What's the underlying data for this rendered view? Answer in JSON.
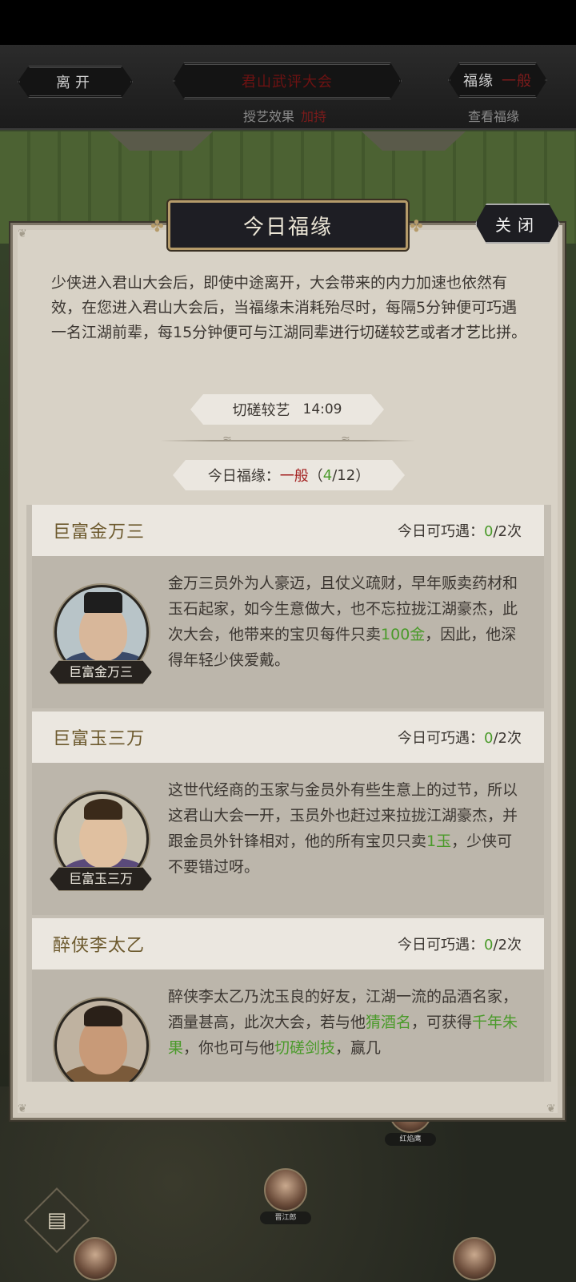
{
  "top_bar": {
    "leave_label": "离开",
    "event_title": "君山武评大会",
    "fortune_label": "福缘",
    "fortune_level": "一般",
    "teach_effect_label": "授艺效果",
    "teach_effect_value": "加持",
    "view_fortune_label": "查看福缘"
  },
  "modal": {
    "title": "今日福缘",
    "close_label": "关闭",
    "intro": "少侠进入君山大会后，即使中途离开，大会带来的内力加速也依然有效，在您进入君山大会后，当福缘未消耗殆尽时，每隔5分钟便可巧遇一名江湖前辈，每15分钟便可与江湖同辈进行切磋较艺或者才艺比拼。",
    "spar": {
      "label": "切磋较艺",
      "time": "14:09"
    },
    "fortune": {
      "label": "今日福缘：",
      "level": "一般",
      "open": "（",
      "used": "4",
      "total": "/12",
      "close": "）"
    }
  },
  "cards": [
    {
      "name": "巨富金万三",
      "count_label": "今日可巧遇：",
      "count_used": "0",
      "count_total": "/2次",
      "plate": "巨富金万三",
      "text_a": "金万三员外为人豪迈，且仗义疏财，早年贩卖药材和玉石起家，如今生意做大，也不忘拉拢江湖豪杰，此次大会，他带来的宝贝每件只卖",
      "highlight_a": "100金",
      "text_b": "，因此，他深得年轻少侠爱戴。"
    },
    {
      "name": "巨富玉三万",
      "count_label": "今日可巧遇：",
      "count_used": "0",
      "count_total": "/2次",
      "plate": "巨富玉三万",
      "text_a": "这世代经商的玉家与金员外有些生意上的过节，所以这君山大会一开，玉员外也赶过来拉拢江湖豪杰，并跟金员外针锋相对，他的所有宝贝只卖",
      "highlight_a": "1玉",
      "text_b": "，少侠可不要错过呀。"
    },
    {
      "name": "醉侠李太乙",
      "count_label": "今日可巧遇：",
      "count_used": "0",
      "count_total": "/2次",
      "text_a": "醉侠李太乙乃沈玉良的好友，江湖一流的品酒名家，酒量甚高，此次大会，若与他",
      "highlight_a": "猜酒名",
      "text_b": "，可获得",
      "highlight_b": "千年朱果",
      "text_c": "，你也可与他",
      "highlight_c": "切磋剑技",
      "text_d": "，赢几"
    }
  ],
  "scene": {
    "npc_labels": [
      "红焰鹰",
      "晋江郎"
    ]
  },
  "colors": {
    "accent_green": "#4a9a2a",
    "accent_red": "#a32020",
    "panel_bg": "#d8d2c6",
    "header_gold": "#b59b6a"
  },
  "icons": {
    "chat": "chat-bubble-icon"
  }
}
